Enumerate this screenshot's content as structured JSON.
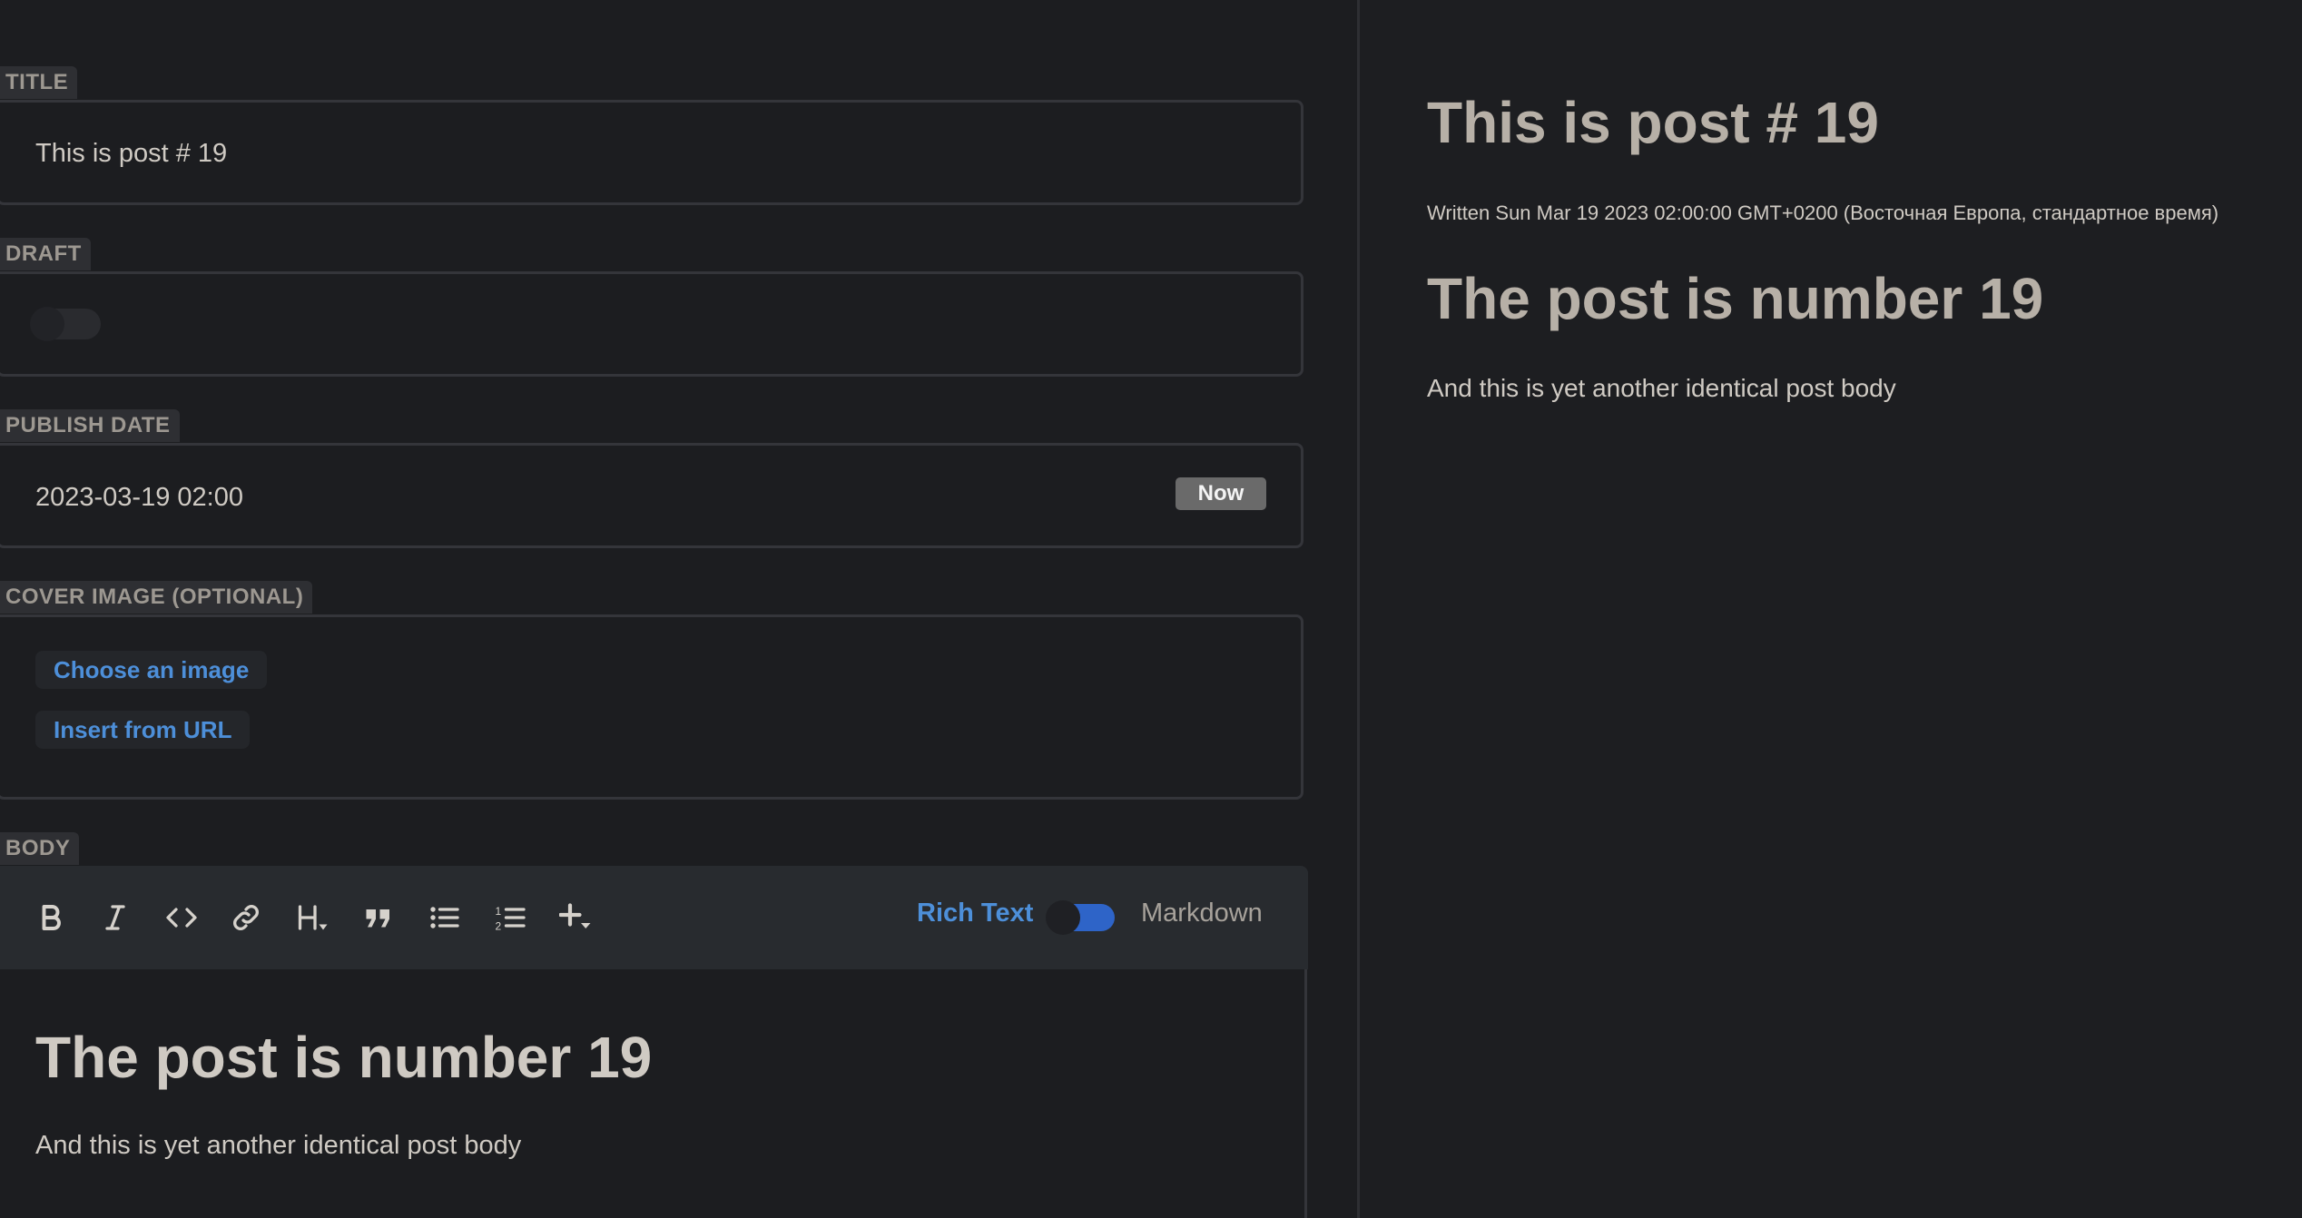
{
  "editor": {
    "title": {
      "label": "TITLE",
      "value": "This is post # 19"
    },
    "draft": {
      "label": "DRAFT",
      "enabled": false
    },
    "publish_date": {
      "label": "PUBLISH DATE",
      "value": "2023-03-19 02:00",
      "now_button": "Now"
    },
    "cover_image": {
      "label": "COVER IMAGE (OPTIONAL)",
      "choose_button": "Choose an image",
      "url_button": "Insert from URL"
    },
    "body": {
      "label": "BODY",
      "toolbar": {
        "tools": [
          "bold-icon",
          "italic-icon",
          "code-icon",
          "link-icon",
          "heading-icon",
          "quote-icon",
          "bullet-list-icon",
          "numbered-list-icon",
          "insert-icon"
        ],
        "rich_text_label": "Rich Text",
        "markdown_label": "Markdown",
        "mode": "Rich Text"
      },
      "heading": "The post is number 19",
      "text": "And this is yet another identical post body"
    }
  },
  "preview": {
    "title": "This is post # 19",
    "meta": "Written Sun Mar 19 2023 02:00:00 GMT+0200 (Восточная Европа, стандартное время)",
    "heading": "The post is number 19",
    "text": "And this is yet another identical post body"
  },
  "colors": {
    "background": "#1c1d20",
    "accent": "#4d8fd9",
    "toggle_on": "#2e64c8",
    "label_bg": "#2e2f33",
    "toolbar_bg": "#282b2f"
  }
}
